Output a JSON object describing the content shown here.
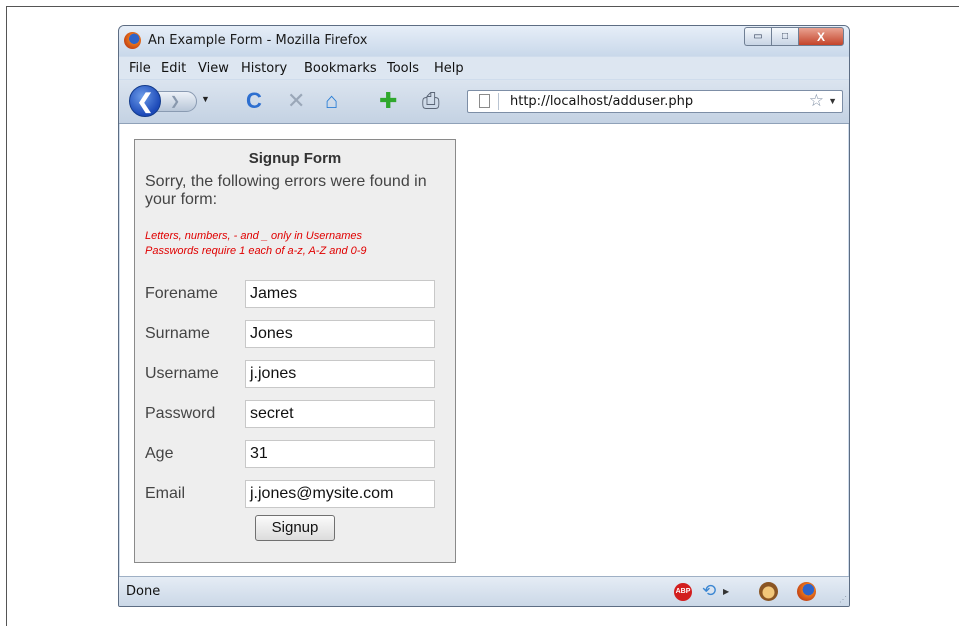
{
  "window": {
    "title": "An Example Form - Mozilla Firefox",
    "minimize_glyph": "▭",
    "maximize_glyph": "□",
    "close_glyph": "X"
  },
  "menu": [
    "File",
    "Edit",
    "View",
    "History",
    "Bookmarks",
    "Tools",
    "Help"
  ],
  "toolbar": {
    "back_glyph": "❮",
    "forward_glyph": "❯",
    "reload_glyph": "C",
    "stop_glyph": "✕",
    "home_glyph": "⌂",
    "add_glyph": "✚",
    "print_glyph": "⎙",
    "url": "http://localhost/adduser.php",
    "star_glyph": "☆"
  },
  "form": {
    "title": "Signup Form",
    "message": "Sorry, the following errors were found in your form:",
    "errors": [
      "Letters, numbers, - and _ only in Usernames",
      "Passwords require 1 each of a-z, A-Z and 0-9"
    ],
    "fields": [
      {
        "label": "Forename",
        "value": "James"
      },
      {
        "label": "Surname",
        "value": "Jones"
      },
      {
        "label": "Username",
        "value": "j.jones"
      },
      {
        "label": "Password",
        "value": "secret"
      },
      {
        "label": "Age",
        "value": "31"
      },
      {
        "label": "Email",
        "value": "j.jones@mysite.com"
      }
    ],
    "submit_label": "Signup"
  },
  "status": {
    "text": "Done",
    "abp_text": "ABP"
  },
  "icons": [
    "firefox-logo-icon",
    "back-icon",
    "forward-icon",
    "reload-icon",
    "stop-icon",
    "home-icon",
    "add-bookmark-icon",
    "print-icon",
    "page-icon",
    "star-icon",
    "adblock-icon",
    "sync-icon",
    "greasemonkey-icon",
    "firefox-icon",
    "resize-grip-icon"
  ],
  "colors": {
    "error_text": "#e00000",
    "form_background": "#eeeeee",
    "chrome_blue": "#cfdcec"
  }
}
